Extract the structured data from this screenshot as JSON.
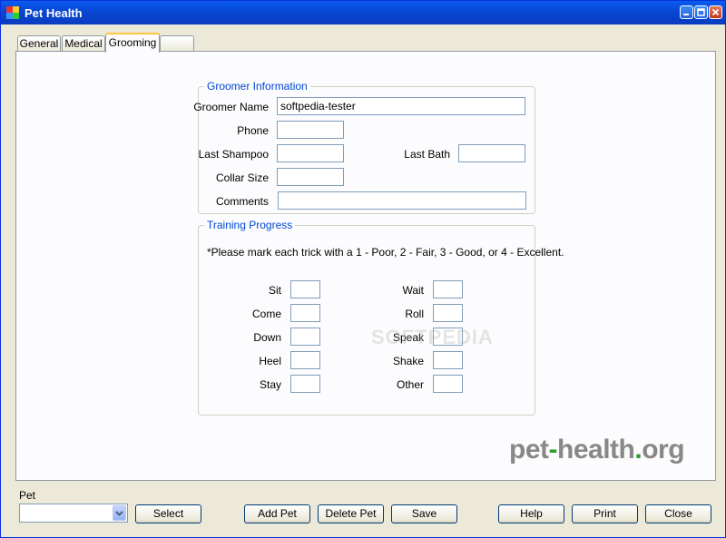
{
  "window": {
    "title": "Pet Health"
  },
  "tabs": [
    {
      "label": "General"
    },
    {
      "label": "Medical"
    },
    {
      "label": "Grooming"
    },
    {
      "label": ""
    }
  ],
  "groomer": {
    "title": "Groomer Information",
    "fields": {
      "groomer_name": {
        "label": "Groomer Name",
        "value": "softpedia-tester"
      },
      "phone": {
        "label": "Phone",
        "value": ""
      },
      "last_shampoo": {
        "label": "Last Shampoo",
        "value": ""
      },
      "last_bath": {
        "label": "Last Bath",
        "value": ""
      },
      "collar_size": {
        "label": "Collar Size",
        "value": ""
      },
      "comments": {
        "label": "Comments",
        "value": ""
      }
    }
  },
  "training": {
    "title": "Training Progress",
    "instructions": "*Please mark each trick with a 1 - Poor, 2 - Fair, 3 - Good, or 4 - Excellent.",
    "left": [
      {
        "label": "Sit",
        "value": ""
      },
      {
        "label": "Come",
        "value": ""
      },
      {
        "label": "Down",
        "value": ""
      },
      {
        "label": "Heel",
        "value": ""
      },
      {
        "label": "Stay",
        "value": ""
      }
    ],
    "right": [
      {
        "label": "Wait",
        "value": ""
      },
      {
        "label": "Roll",
        "value": ""
      },
      {
        "label": "Speak",
        "value": ""
      },
      {
        "label": "Shake",
        "value": ""
      },
      {
        "label": "Other",
        "value": ""
      }
    ]
  },
  "brand": {
    "prefix": "pet",
    "dash": "-",
    "middle": "health",
    "dot": ".",
    "suffix": "org"
  },
  "watermark": "SOFTPEDIA",
  "bottom": {
    "pet_label": "Pet",
    "pet_value": "",
    "select": "Select",
    "add_pet": "Add Pet",
    "delete_pet": "Delete Pet",
    "save": "Save",
    "help": "Help",
    "print": "Print",
    "close": "Close"
  },
  "colors": {
    "titlebar": "#0846d3",
    "group_title": "#0046d5",
    "brand_gray": "#888888",
    "brand_green": "#2e9e2e",
    "tab_accent": "#ffc83c"
  },
  "icons": {
    "app": "pet-health-app-icon",
    "minimize": "minimize-icon",
    "maximize": "maximize-icon",
    "close": "close-icon",
    "dropdown": "chevron-down-icon"
  }
}
